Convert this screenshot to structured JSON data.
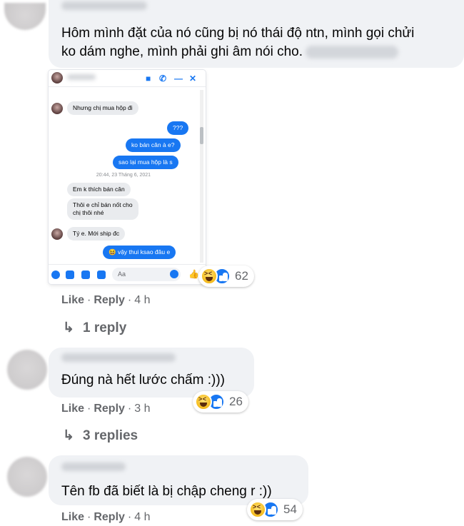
{
  "comments": [
    {
      "text": "Hôm mình đặt của nó cũng bị nó thái độ ntn, mình gọi chửi",
      "text_line2": "ko dám nghe, mình phải ghi âm nói cho.",
      "actions": {
        "like": "Like",
        "reply": "Reply",
        "time": "4 h"
      },
      "reaction_count": "62",
      "replies_label": "1 reply"
    },
    {
      "text": "Đúng nà hết lước chấm :)))",
      "actions": {
        "like": "Like",
        "reply": "Reply",
        "time": "3 h"
      },
      "reaction_count": "26",
      "replies_label": "3 replies"
    },
    {
      "text": "Tên fb đã biết là bị chập cheng r :))",
      "actions": {
        "like": "Like",
        "reply": "Reply",
        "time": "4 h"
      },
      "reaction_count": "54"
    }
  ],
  "chat_screenshot": {
    "header_icons": [
      "video-icon",
      "phone-icon",
      "minimize-icon",
      "close-icon"
    ],
    "messages": [
      {
        "from": "them",
        "text": "Nhưng chị mua hộp đi"
      },
      {
        "from": "me",
        "text": "???"
      },
      {
        "from": "me",
        "text": "ko bán cân à e?"
      },
      {
        "from": "me",
        "text": "sao lại mua hộp là s"
      },
      {
        "from": "timestamp",
        "text": "20:44, 23 Tháng 6, 2021"
      },
      {
        "from": "them",
        "text": "Em k thích bán cân"
      },
      {
        "from": "them",
        "text": "Thôi e chỉ bán nốt cho",
        "text_line2": "chị thôi nhé"
      },
      {
        "from": "them",
        "text": "Tý e. Mới ship đc"
      },
      {
        "from": "me",
        "text": "😆 vậy thui ksao đâu e"
      }
    ],
    "composer_placeholder": "Aa"
  },
  "colors": {
    "accent": "#1877f2",
    "bubble": "#f0f2f5",
    "meta": "#65676b"
  }
}
